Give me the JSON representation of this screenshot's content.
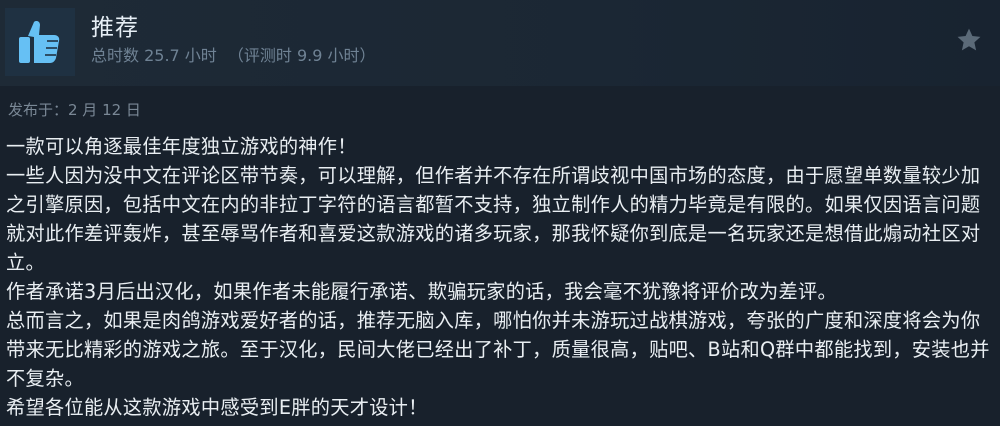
{
  "review": {
    "recommendation": "推荐",
    "hours_total": "总时数 25.7 小时",
    "hours_at_review": "（评测时 9.9 小时）",
    "posted_date": "发布于：2 月 12 日",
    "icons": {
      "thumb": "thumbs-up-icon",
      "star": "star-icon"
    },
    "colors": {
      "thumb": "#66c0f4",
      "thumb_bg": "#1f3142",
      "star": "#5b6a78",
      "text": "#e9eef2",
      "muted": "#6f8294"
    },
    "paragraphs": [
      "一款可以角逐最佳年度独立游戏的神作！",
      "一些人因为没中文在评论区带节奏，可以理解，但作者并不存在所谓歧视中国市场的态度，由于愿望单数量较少加之引擎原因，包括中文在内的非拉丁字符的语言都暂不支持，独立制作人的精力毕竟是有限的。如果仅因语言问题就对此作差评轰炸，甚至辱骂作者和喜爱这款游戏的诸多玩家，那我怀疑你到底是一名玩家还是想借此煽动社区对立。",
      "作者承诺3月后出汉化，如果作者未能履行承诺、欺骗玩家的话，我会毫不犹豫将评价改为差评。",
      "总而言之，如果是肉鸽游戏爱好者的话，推荐无脑入库，哪怕你并未游玩过战棋游戏，夸张的广度和深度将会为你带来无比精彩的游戏之旅。至于汉化，民间大佬已经出了补丁，质量很高，贴吧、B站和Q群中都能找到，安装也并不复杂。",
      "希望各位能从这款游戏中感受到E胖的天才设计！"
    ]
  }
}
